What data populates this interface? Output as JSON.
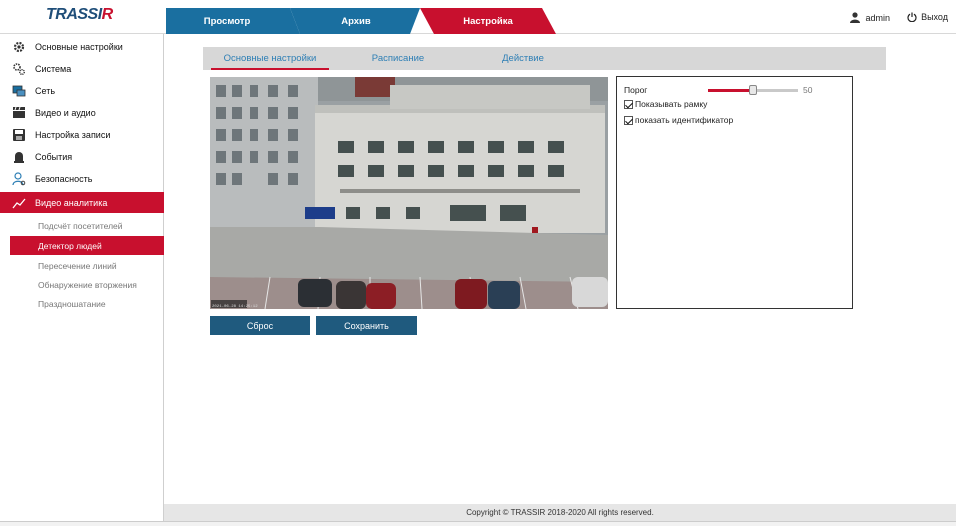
{
  "app": {
    "logo_main": "TRASSI",
    "logo_accent": "R"
  },
  "header": {
    "tabs": [
      {
        "label": "Просмотр",
        "active": false
      },
      {
        "label": "Архив",
        "active": false
      },
      {
        "label": "Настройка",
        "active": true
      }
    ],
    "user": "admin",
    "logout_label": "Выход"
  },
  "sidebar": {
    "items": [
      {
        "label": "Основные настройки",
        "icon": "gear-icon"
      },
      {
        "label": "Система",
        "icon": "gears-icon"
      },
      {
        "label": "Сеть",
        "icon": "network-icon"
      },
      {
        "label": "Видео и аудио",
        "icon": "film-icon"
      },
      {
        "label": "Настройка записи",
        "icon": "save-icon"
      },
      {
        "label": "События",
        "icon": "alarm-icon"
      },
      {
        "label": "Безопасность",
        "icon": "user-lock-icon"
      },
      {
        "label": "Видео аналитика",
        "icon": "analytics-icon",
        "active": true
      }
    ],
    "subitems": [
      {
        "label": "Подсчёт посетителей"
      },
      {
        "label": "Детектор людей",
        "active": true
      },
      {
        "label": "Пересечение линий"
      },
      {
        "label": "Обнаружение вторжения"
      },
      {
        "label": "Праздношатание"
      }
    ]
  },
  "subtabs": [
    {
      "label": "Основные настройки",
      "active": true
    },
    {
      "label": "Расписание"
    },
    {
      "label": "Действие"
    }
  ],
  "video": {
    "timestamp": "2021-06-28 14:25:12"
  },
  "buttons": {
    "reset": "Сброс",
    "save": "Сохранить"
  },
  "panel": {
    "threshold_label": "Порог",
    "threshold_value": "50",
    "threshold_fraction": 0.5,
    "show_frame_label": "Показывать рамку",
    "show_frame_checked": true,
    "show_id_label": "показать идентификатор",
    "show_id_checked": true
  },
  "footer": {
    "copyright": "Copyright © TRASSIR 2018-2020 All rights reserved."
  },
  "colors": {
    "accent_red": "#c8102e",
    "tab_blue": "#1a6fa0",
    "button_blue": "#1f5a7e"
  }
}
